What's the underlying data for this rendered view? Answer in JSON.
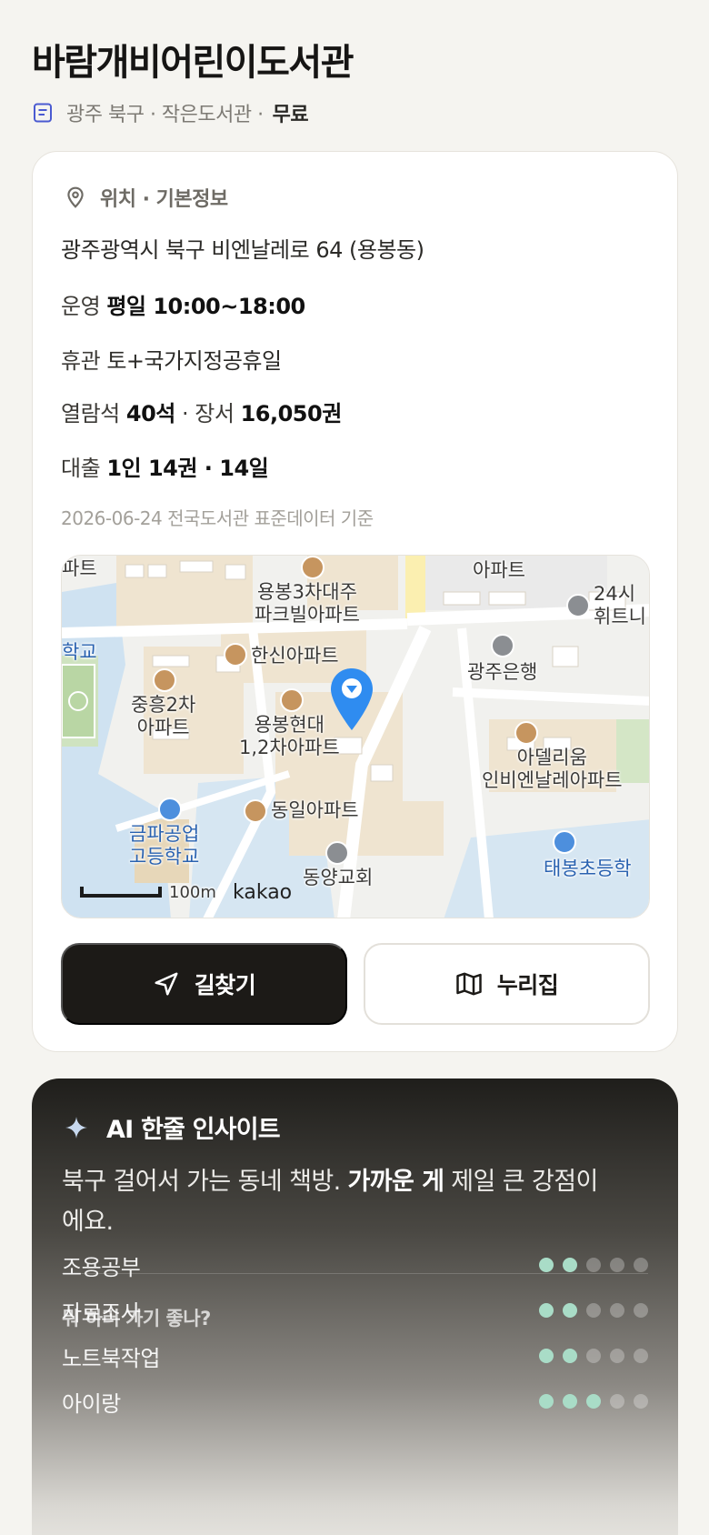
{
  "header": {
    "title": "바람개비어린이도서관",
    "meta_prefix": "광주 북구 · 작은도서관 ·",
    "fee": "무료"
  },
  "info": {
    "section_title": "위치 · 기본정보",
    "address": "광주광역시 북구 비엔날레로 64 (용봉동)",
    "hours_label": "운영",
    "hours_value": "평일 10:00~18:00",
    "closed_label": "휴관",
    "closed_value": "토+국가지정공휴일",
    "seats_label": "열람석",
    "seats_value": "40석",
    "books_sep": "· 장서",
    "books_value": "16,050권",
    "loan_label": "대출",
    "loan_value": "1인 14권 · 14일",
    "source": "2026-06-24 전국도서관 표준데이터 기준"
  },
  "map": {
    "labels": [
      "파트",
      "용봉3차대주\n파크빌아파트",
      "아파트",
      "24시\n휘트니",
      "학교",
      "한신아파트",
      "광주은행",
      "중흥2차\n아파트",
      "용봉현대\n1,2차아파트",
      "아델리움\n인비엔날레아파트",
      "동일아파트",
      "금파공업\n고등학교",
      "태봉초등학",
      "동양교회",
      "100m"
    ],
    "attribution": "kakao",
    "scale": "100m"
  },
  "actions": {
    "directions": "길찾기",
    "website": "누리집"
  },
  "ai": {
    "heading": "AI 한줄 인사이트",
    "text_before": "북구 걸어서 가는 동네 책방.",
    "text_bold": "가까운 게",
    "text_after": "제일 큰 강점이에요.",
    "question": "뭐 하러 가기 좋나?",
    "activities": [
      {
        "label": "조용공부",
        "score": 2,
        "max": 5
      },
      {
        "label": "자료조사",
        "score": 2,
        "max": 5
      },
      {
        "label": "노트북작업",
        "score": 2,
        "max": 5
      },
      {
        "label": "아이랑",
        "score": 3,
        "max": 5
      }
    ]
  },
  "colors": {
    "background": "#f5f4f0",
    "primary_button": "#1c1a17",
    "marker": "#2f8cf0",
    "dot_on": "#a9dcc7"
  }
}
